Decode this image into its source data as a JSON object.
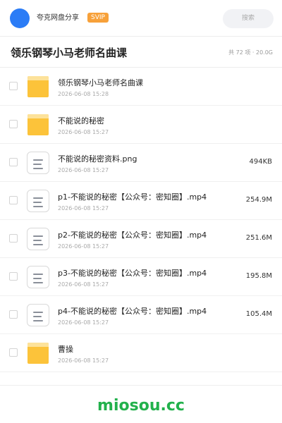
{
  "header": {
    "username": "夸克网盘分享",
    "badge": "SVIP",
    "search_label": "搜索",
    "colors": {
      "avatar": "#2b7cf6",
      "badge": "#f7a13a"
    }
  },
  "share": {
    "title": "领乐钢琴小马老师名曲课",
    "meta": "共 72 项 · 20.0G"
  },
  "files": [
    {
      "icon": "folder-icon",
      "name": "领乐钢琴小马老师名曲课",
      "date": "2026-06-08 15:28",
      "size": ""
    },
    {
      "icon": "folder-icon",
      "name": "不能说的秘密",
      "date": "2026-06-08 15:27",
      "size": ""
    },
    {
      "icon": "file-icon",
      "name": "不能说的秘密资料.png",
      "date": "2026-06-08 15:27",
      "size": "494KB"
    },
    {
      "icon": "file-icon",
      "name": "p1-不能说的秘密【公众号：密知圈】.mp4",
      "date": "2026-06-08 15:27",
      "size": "254.9M"
    },
    {
      "icon": "file-icon",
      "name": "p2-不能说的秘密【公众号：密知圈】.mp4",
      "date": "2026-06-08 15:27",
      "size": "251.6M"
    },
    {
      "icon": "file-icon",
      "name": "p3-不能说的秘密【公众号：密知圈】.mp4",
      "date": "2026-06-08 15:27",
      "size": "195.8M"
    },
    {
      "icon": "file-icon",
      "name": "p4-不能说的秘密【公众号：密知圈】.mp4",
      "date": "2026-06-08 15:27",
      "size": "105.4M"
    },
    {
      "icon": "folder-icon",
      "name": "曹操",
      "date": "2026-06-08 15:27",
      "size": ""
    }
  ],
  "watermark": "miosou.cc",
  "colors": {
    "folder": "#fcc33a",
    "watermark": "#22b14c"
  }
}
